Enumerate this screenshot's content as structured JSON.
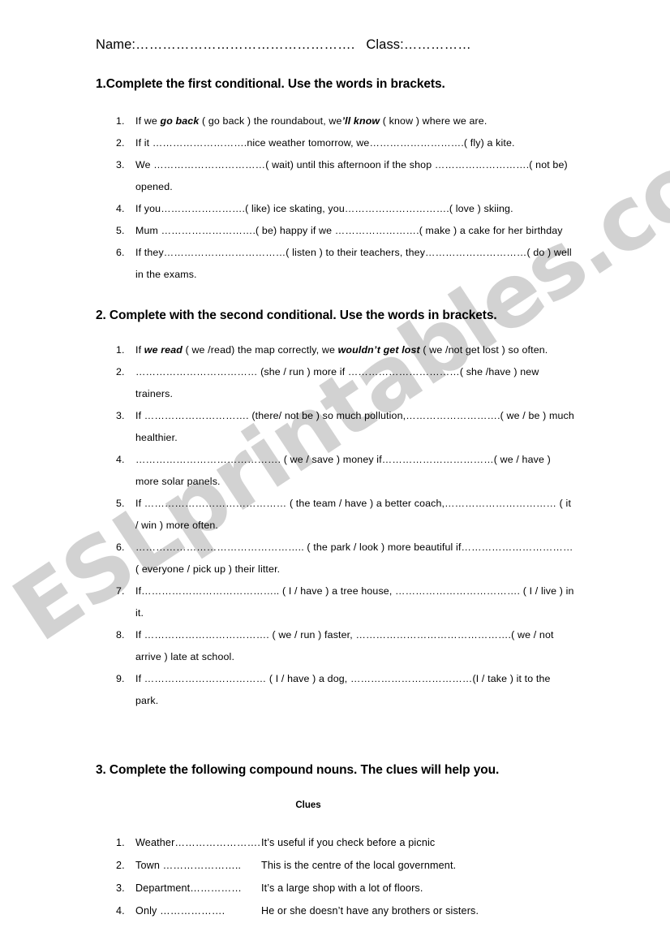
{
  "page": {
    "watermark_text": "ESLprintables.com",
    "watermark_color": "#d2d2d2",
    "background_color": "#ffffff",
    "text_color": "#000000"
  },
  "header": {
    "name_label": "Name:………………………………………….",
    "class_label": "Class:……………"
  },
  "sections": [
    {
      "id": "section-1",
      "heading": "1.Complete the first conditional. Use the words in brackets.",
      "items": [
        {
          "num": "1.",
          "parts": [
            {
              "t": "If we ",
              "b": false
            },
            {
              "t": "go back",
              "b": true
            },
            {
              "t": " ( go back ) the roundabout, we",
              "b": false
            },
            {
              "t": "’ll know",
              "b": true
            },
            {
              "t": " ( know ) where we are.",
              "b": false
            }
          ]
        },
        {
          "num": "2.",
          "parts": [
            {
              "t": "If it ……………………….nice weather tomorrow, we……………………….( fly) a kite.",
              "b": false
            }
          ]
        },
        {
          "num": "3.",
          "parts": [
            {
              "t": "We ……………………………( wait) until this afternoon if the shop ……………………….( not be) opened.",
              "b": false
            }
          ]
        },
        {
          "num": "4.",
          "parts": [
            {
              "t": "If you…………………….( like) ice skating, you………………………….( love ) skiing.",
              "b": false
            }
          ]
        },
        {
          "num": "5.",
          "parts": [
            {
              "t": "Mum ……………………….( be) happy if we …………………….( make ) a cake for her birthday",
              "b": false
            }
          ]
        },
        {
          "num": "6.",
          "parts": [
            {
              "t": "If they………………………………( listen ) to their teachers, they…………………………( do ) well in the exams.",
              "b": false
            }
          ]
        }
      ]
    },
    {
      "id": "section-2",
      "heading": "2. Complete with the second conditional. Use the words in brackets.",
      "items": [
        {
          "num": "1.",
          "parts": [
            {
              "t": "If ",
              "b": false
            },
            {
              "t": "we read",
              "b": true
            },
            {
              "t": "  ( we /read) the map correctly, we ",
              "b": false
            },
            {
              "t": "wouldn’t get lost",
              "b": true
            },
            {
              "t": " ( we /not get lost ) so often.",
              "b": false
            }
          ]
        },
        {
          "num": "2.",
          "parts": [
            {
              "t": "……………………………… (she / run ) more if ……………………………( she /have ) new trainers.",
              "b": false
            }
          ]
        },
        {
          "num": "3.",
          "parts": [
            {
              "t": "If …………………………. (there/ not be ) so much pollution,……………………….( we / be ) much healthier.",
              "b": false
            }
          ]
        },
        {
          "num": "4.",
          "parts": [
            {
              "t": "……………………………………. ( we / save ) money if……………………………( we / have ) more solar panels.",
              "b": false
            }
          ]
        },
        {
          "num": "5.",
          "parts": [
            {
              "t": "If …………………………………… ( the team  / have ) a better coach,…………………………… ( it / win ) more often.",
              "b": false
            }
          ]
        },
        {
          "num": "6.",
          "parts": [
            {
              "t": "………………………………………….. ( the park / look ) more beautiful if…………………………… ( everyone / pick up ) their litter.",
              "b": false
            }
          ]
        },
        {
          "num": "7.",
          "parts": [
            {
              "t": "If………………………………….. ( I / have ) a tree house, ………………………………. ( I / live ) in it.",
              "b": false
            }
          ]
        },
        {
          "num": "8.",
          "parts": [
            {
              "t": "If ………………………………. ( we / run ) faster, ……………………………………….( we / not arrive ) late at school.",
              "b": false
            }
          ]
        },
        {
          "num": "9.",
          "parts": [
            {
              "t": "If ……………………………… ( I / have ) a dog, ………………………………(I / take ) it to the park.",
              "b": false
            }
          ]
        }
      ]
    },
    {
      "id": "section-3",
      "heading": "3.  Complete the following compound nouns. The clues will help you.",
      "clues_label": "Clues",
      "clues": [
        {
          "num": "1.",
          "term": "Weather…………………….",
          "clue": "It’s useful if you check before a picnic"
        },
        {
          "num": "2.",
          "term": "Town …………………..",
          "clue": "This is the centre of the local government."
        },
        {
          "num": "3.",
          "term": "Department……………",
          "clue": "It’s a large shop with a lot of floors."
        },
        {
          "num": "4.",
          "term": "Only ……………….",
          "clue": "He or she doesn’t have any brothers or sisters."
        }
      ]
    }
  ]
}
